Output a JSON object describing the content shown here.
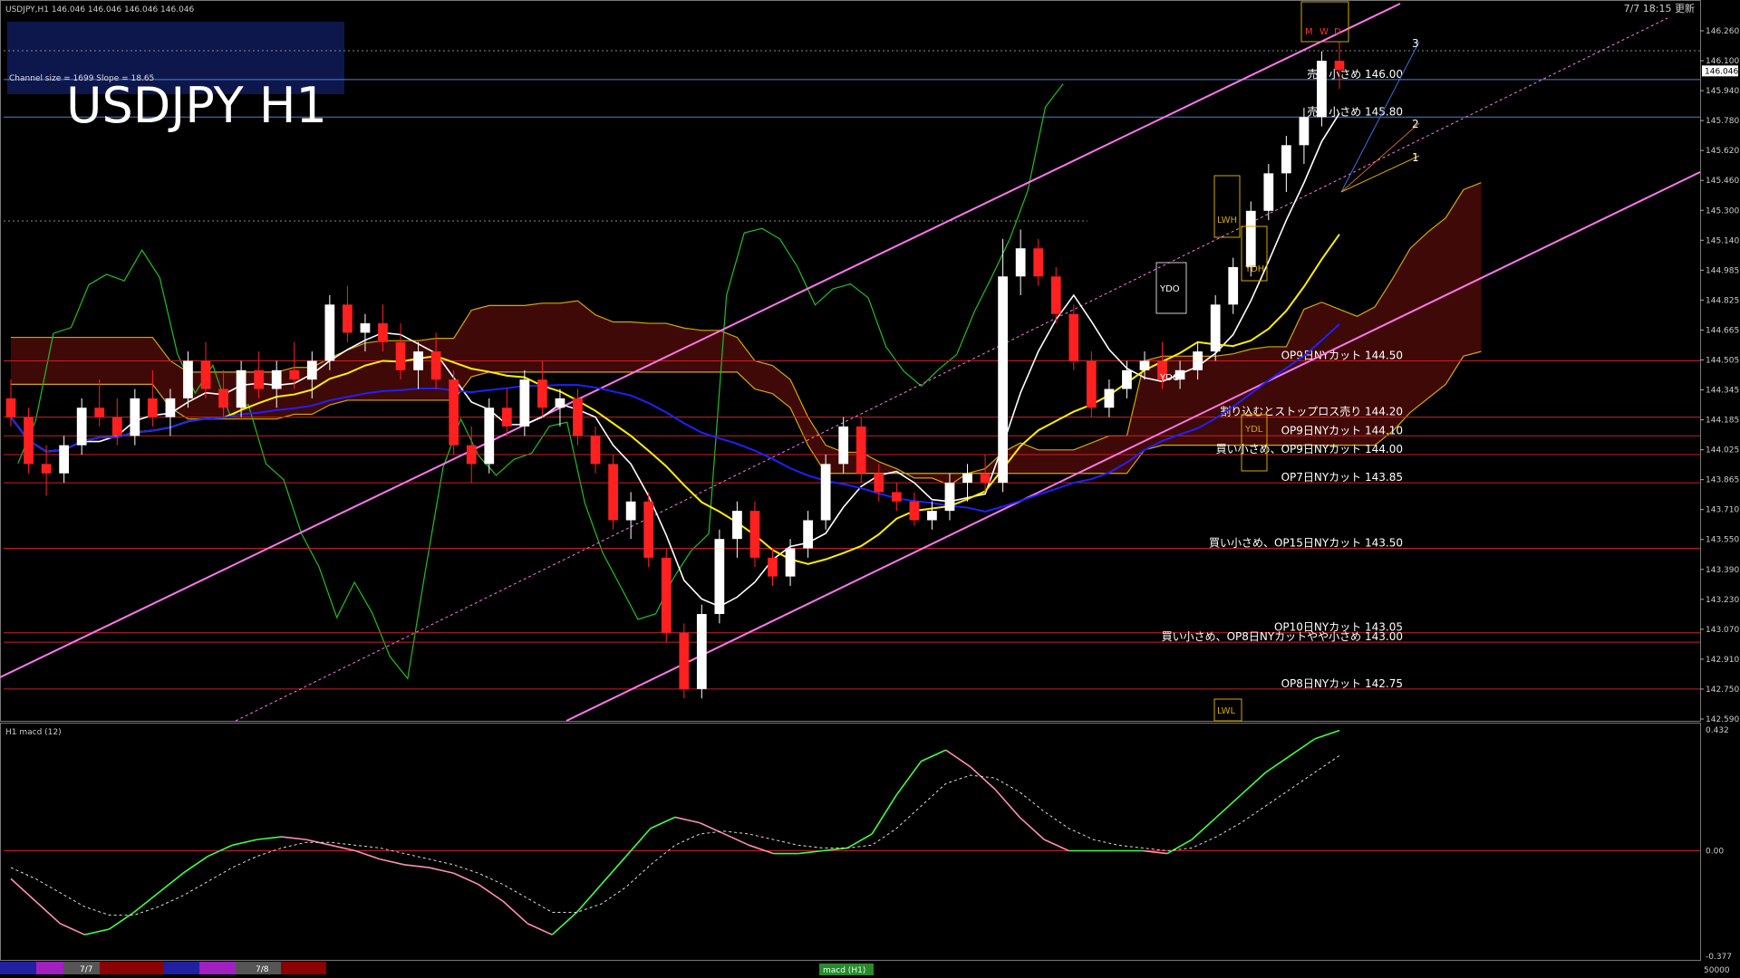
{
  "window": {
    "symbol_header": "USDJPY,H1  146.046 146.046 146.046 146.046",
    "datetime": "7/7 18:15 更新"
  },
  "overlay": {
    "title": "USDJPY H1",
    "channel_info": "Channel size = 1699 Slope = 18.65"
  },
  "colors": {
    "background": "#000000",
    "bull_candle": "#ffffff",
    "bear_candle": "#ff2020",
    "ma_fast": "#ffffff",
    "ma_mid": "#ffee00",
    "ma_slow": "#2020ff",
    "channel": "#ff77ee",
    "level_line": "#cc2020",
    "cloud_line": "#d4a800",
    "chikou": "#20c020",
    "macd_up": "#40ff40",
    "macd_down": "#ff8fb0",
    "signal": "#dddddd"
  },
  "price_axis": {
    "ticks": [
      "146.260",
      "146.100",
      "145.940",
      "145.780",
      "145.620",
      "145.460",
      "145.300",
      "145.140",
      "144.985",
      "144.825",
      "144.665",
      "144.505",
      "144.345",
      "144.185",
      "144.025",
      "143.865",
      "143.710",
      "143.550",
      "143.390",
      "143.230",
      "143.070",
      "142.910",
      "142.750",
      "142.590"
    ],
    "current_price": "146.046"
  },
  "levels": [
    {
      "price": 146.0,
      "label": "売り小さめ 146.00"
    },
    {
      "price": 145.8,
      "label": "売り小さめ 145.80"
    },
    {
      "price": 144.5,
      "label": "OP9日NYカット 144.50"
    },
    {
      "price": 144.2,
      "label": "割り込むとストップロス売り 144.20"
    },
    {
      "price": 144.1,
      "label": "OP9日NYカット 144.10"
    },
    {
      "price": 144.0,
      "label": "買い小さめ、OP9日NYカット 144.00"
    },
    {
      "price": 143.85,
      "label": "OP7日NYカット 143.85"
    },
    {
      "price": 143.5,
      "label": "買い小さめ、OP15日NYカット 143.50"
    },
    {
      "price": 143.05,
      "label": "OP10日NYカット 143.05"
    },
    {
      "price": 143.0,
      "label": "買い小さめ、OP8日NYカットやや小さめ 143.00"
    },
    {
      "price": 142.75,
      "label": "OP8日NYカット 142.75"
    }
  ],
  "markers": {
    "ydo": "YDO",
    "ydc": "YDC",
    "ydh": "YDH",
    "ydl": "YDL",
    "lwh": "LWH",
    "lwl": "LWL",
    "m": "M",
    "w": "W",
    "d": "D",
    "ray1": "1",
    "ray2": "2",
    "ray3": "3"
  },
  "macd_panel": {
    "label": "H1  macd (12)",
    "ticks": [
      "0.432",
      "0.00",
      "-0.377"
    ],
    "bottom_value": "50000",
    "dates": [
      "7/7",
      "7/8"
    ],
    "tab": "macd (H1)"
  },
  "chart_data": {
    "type": "candlestick",
    "title": "USDJPY H1",
    "ylim": [
      142.59,
      146.26
    ],
    "candles_approx": [
      [
        144.3,
        144.4,
        144.15,
        144.2
      ],
      [
        144.2,
        144.25,
        143.9,
        143.95
      ],
      [
        143.95,
        144.05,
        143.78,
        143.9
      ],
      [
        143.9,
        144.1,
        143.85,
        144.05
      ],
      [
        144.05,
        144.3,
        144.0,
        144.25
      ],
      [
        144.25,
        144.4,
        144.15,
        144.2
      ],
      [
        144.2,
        144.3,
        144.05,
        144.1
      ],
      [
        144.1,
        144.35,
        144.05,
        144.3
      ],
      [
        144.3,
        144.45,
        144.15,
        144.2
      ],
      [
        144.2,
        144.35,
        144.1,
        144.3
      ],
      [
        144.3,
        144.55,
        144.25,
        144.5
      ],
      [
        144.5,
        144.6,
        144.3,
        144.35
      ],
      [
        144.35,
        144.45,
        144.2,
        144.25
      ],
      [
        144.25,
        144.5,
        144.2,
        144.45
      ],
      [
        144.45,
        144.55,
        144.3,
        144.35
      ],
      [
        144.35,
        144.5,
        144.25,
        144.45
      ],
      [
        144.45,
        144.6,
        144.35,
        144.4
      ],
      [
        144.4,
        144.55,
        144.3,
        144.5
      ],
      [
        144.5,
        144.85,
        144.45,
        144.8
      ],
      [
        144.8,
        144.9,
        144.6,
        144.65
      ],
      [
        144.65,
        144.75,
        144.55,
        144.7
      ],
      [
        144.7,
        144.8,
        144.55,
        144.6
      ],
      [
        144.6,
        144.7,
        144.4,
        144.45
      ],
      [
        144.45,
        144.6,
        144.35,
        144.55
      ],
      [
        144.55,
        144.65,
        144.35,
        144.4
      ],
      [
        144.4,
        144.45,
        144.0,
        144.05
      ],
      [
        144.05,
        144.15,
        143.85,
        143.95
      ],
      [
        143.95,
        144.3,
        143.9,
        144.25
      ],
      [
        144.25,
        144.35,
        144.1,
        144.15
      ],
      [
        144.15,
        144.45,
        144.1,
        144.4
      ],
      [
        144.4,
        144.5,
        144.2,
        144.25
      ],
      [
        144.25,
        144.35,
        144.15,
        144.3
      ],
      [
        144.3,
        144.35,
        144.05,
        144.1
      ],
      [
        144.1,
        144.15,
        143.9,
        143.95
      ],
      [
        143.95,
        144.0,
        143.6,
        143.65
      ],
      [
        143.65,
        143.8,
        143.55,
        143.75
      ],
      [
        143.75,
        143.8,
        143.4,
        143.45
      ],
      [
        143.45,
        143.5,
        143.0,
        143.05
      ],
      [
        143.05,
        143.1,
        142.7,
        142.75
      ],
      [
        142.75,
        143.2,
        142.7,
        143.15
      ],
      [
        143.15,
        143.6,
        143.1,
        143.55
      ],
      [
        143.55,
        143.75,
        143.45,
        143.7
      ],
      [
        143.7,
        143.75,
        143.4,
        143.45
      ],
      [
        143.45,
        143.5,
        143.3,
        143.35
      ],
      [
        143.35,
        143.55,
        143.3,
        143.5
      ],
      [
        143.5,
        143.7,
        143.45,
        143.65
      ],
      [
        143.65,
        144.0,
        143.6,
        143.95
      ],
      [
        143.95,
        144.2,
        143.9,
        144.15
      ],
      [
        144.15,
        144.2,
        143.85,
        143.9
      ],
      [
        143.9,
        143.95,
        143.75,
        143.8
      ],
      [
        143.8,
        143.85,
        143.7,
        143.75
      ],
      [
        143.75,
        143.8,
        143.62,
        143.65
      ],
      [
        143.65,
        143.75,
        143.6,
        143.7
      ],
      [
        143.7,
        143.9,
        143.65,
        143.85
      ],
      [
        143.85,
        143.95,
        143.75,
        143.9
      ],
      [
        143.9,
        144.0,
        143.8,
        143.85
      ],
      [
        143.85,
        145.15,
        143.8,
        144.95
      ],
      [
        144.95,
        145.2,
        144.85,
        145.1
      ],
      [
        145.1,
        145.15,
        144.9,
        144.95
      ],
      [
        144.95,
        145.0,
        144.7,
        144.75
      ],
      [
        144.75,
        144.8,
        144.45,
        144.5
      ],
      [
        144.5,
        144.55,
        144.2,
        144.25
      ],
      [
        144.25,
        144.4,
        144.2,
        144.35
      ],
      [
        144.35,
        144.5,
        144.3,
        144.45
      ],
      [
        144.45,
        144.55,
        144.4,
        144.5
      ],
      [
        144.5,
        144.6,
        144.35,
        144.4
      ],
      [
        144.4,
        144.5,
        144.35,
        144.45
      ],
      [
        144.45,
        144.6,
        144.4,
        144.55
      ],
      [
        144.55,
        144.85,
        144.5,
        144.8
      ],
      [
        144.8,
        145.05,
        144.75,
        145.0
      ],
      [
        145.0,
        145.35,
        144.95,
        145.3
      ],
      [
        145.3,
        145.55,
        145.25,
        145.5
      ],
      [
        145.5,
        145.7,
        145.4,
        145.65
      ],
      [
        145.65,
        145.85,
        145.55,
        145.8
      ],
      [
        145.8,
        146.15,
        145.75,
        146.1
      ],
      [
        146.1,
        146.2,
        145.95,
        146.05
      ]
    ],
    "series": [
      {
        "name": "macd",
        "values": [
          -0.1,
          -0.18,
          -0.26,
          -0.3,
          -0.28,
          -0.22,
          -0.15,
          -0.08,
          -0.02,
          0.02,
          0.04,
          0.05,
          0.04,
          0.02,
          0.0,
          -0.03,
          -0.05,
          -0.06,
          -0.08,
          -0.12,
          -0.18,
          -0.26,
          -0.3,
          -0.22,
          -0.12,
          -0.02,
          0.08,
          0.12,
          0.1,
          0.06,
          0.02,
          -0.01,
          -0.01,
          0.0,
          0.01,
          0.06,
          0.2,
          0.32,
          0.36,
          0.3,
          0.22,
          0.12,
          0.04,
          0.0,
          0.0,
          0.0,
          0.0,
          -0.01,
          0.04,
          0.12,
          0.2,
          0.28,
          0.34,
          0.4,
          0.43
        ]
      },
      {
        "name": "signal",
        "values": [
          -0.06,
          -0.1,
          -0.15,
          -0.2,
          -0.23,
          -0.23,
          -0.2,
          -0.16,
          -0.11,
          -0.06,
          -0.02,
          0.01,
          0.03,
          0.03,
          0.02,
          0.01,
          -0.01,
          -0.03,
          -0.05,
          -0.08,
          -0.12,
          -0.17,
          -0.22,
          -0.22,
          -0.19,
          -0.13,
          -0.05,
          0.02,
          0.06,
          0.07,
          0.06,
          0.04,
          0.02,
          0.01,
          0.01,
          0.02,
          0.08,
          0.16,
          0.24,
          0.27,
          0.26,
          0.21,
          0.14,
          0.08,
          0.04,
          0.02,
          0.01,
          0.0,
          0.01,
          0.05,
          0.1,
          0.16,
          0.22,
          0.28,
          0.34
        ]
      }
    ],
    "ylabel_macd_range": [
      -0.377,
      0.432
    ]
  }
}
